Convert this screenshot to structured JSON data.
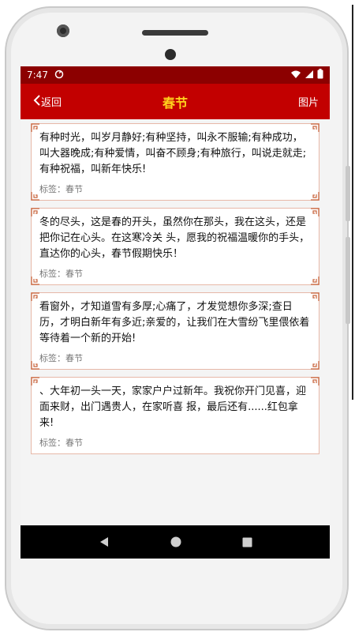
{
  "status_bar": {
    "time": "7:47",
    "icons": [
      "sync-icon",
      "wifi-icon",
      "signal-icon",
      "battery-icon"
    ]
  },
  "app_bar": {
    "back_label": "返回",
    "title": "春节",
    "image_label": "图片"
  },
  "cards": [
    {
      "text": " 有种时光，叫岁月静好;有种坚持，叫永不服输;有种成功，叫大器晚成;有种爱情，叫奋不顾身;有种旅行，叫说走就走;有种祝福，叫新年快乐!",
      "tag": "标签：春节"
    },
    {
      "text": "冬的尽头，这是春的开头，虽然你在那头，我在这头，还是把你记在心头。在这寒冷关 头，愿我的祝福温暖你的手头，直达你的心头，春节假期快乐！",
      "tag": "标签：春节"
    },
    {
      "text": " 看窗外，才知道雪有多厚;心痛了，才发觉想你多深;查日历，才明白新年有多近;亲爱的，让我们在大雪纷飞里偎依着等待着一个新的开始!",
      "tag": "标签：春节"
    },
    {
      "text": "、大年初一头一天，家家户户过新年。我祝你开门见喜，迎面来财，出门遇贵人，在家听喜 报，最后还有......红包拿来!",
      "tag": "标签：春节"
    }
  ],
  "colors": {
    "status_bar": "#8c0000",
    "app_bar": "#c20000",
    "title": "#ffd21e",
    "card_border": "#e7b8a8",
    "corner_ornament": "#c8643c"
  }
}
